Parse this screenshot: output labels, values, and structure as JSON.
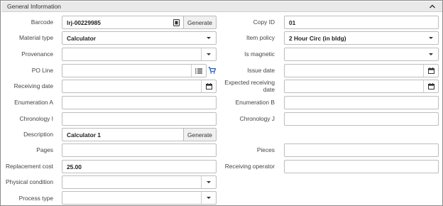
{
  "section": {
    "title": "General Information"
  },
  "left": {
    "barcode": {
      "label": "Barcode",
      "value": "lrj-00229985",
      "button": "Generate"
    },
    "material_type": {
      "label": "Material type",
      "value": "Calculator"
    },
    "provenance": {
      "label": "Provenance",
      "value": ""
    },
    "po_line": {
      "label": "PO Line",
      "value": ""
    },
    "receiving_date": {
      "label": "Receiving date",
      "value": ""
    },
    "enumeration_a": {
      "label": "Enumeration A",
      "value": ""
    },
    "chronology_i": {
      "label": "Chronology I",
      "value": ""
    },
    "description": {
      "label": "Description",
      "value": "Calculator 1",
      "button": "Generate"
    },
    "pages": {
      "label": "Pages",
      "value": ""
    },
    "replacement_cost": {
      "label": "Replacement cost",
      "value": "25.00"
    },
    "physical_condition": {
      "label": "Physical condition",
      "value": ""
    },
    "process_type": {
      "label": "Process type",
      "value": ""
    }
  },
  "right": {
    "copy_id": {
      "label": "Copy ID",
      "value": "01"
    },
    "item_policy": {
      "label": "Item policy",
      "value": "2 Hour Circ (in  bldg)"
    },
    "is_magnetic": {
      "label": "Is magnetic",
      "value": ""
    },
    "issue_date": {
      "label": "Issue date",
      "value": ""
    },
    "expected_receiving_date": {
      "label_line1": "Expected receiving",
      "label_line2": "date",
      "value": ""
    },
    "enumeration_b": {
      "label": "Enumeration B",
      "value": ""
    },
    "chronology_j": {
      "label": "Chronology J",
      "value": ""
    },
    "pieces": {
      "label": "Pieces",
      "value": ""
    },
    "receiving_operator": {
      "label": "Receiving operator",
      "value": ""
    }
  },
  "colors": {
    "header_bg": "#e9e9e9",
    "border": "#bdbdbd",
    "cart_icon": "#1f5fc4"
  },
  "icons": [
    "chevron-down-icon",
    "barcode-scan-icon",
    "list-icon",
    "shopping-cart-icon",
    "calendar-icon"
  ]
}
